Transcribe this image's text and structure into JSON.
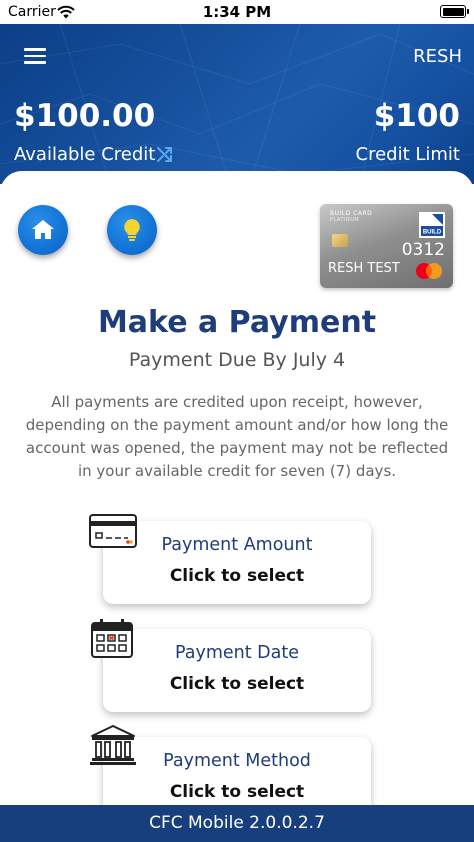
{
  "status_bar": {
    "carrier": "Carrier",
    "time": "1:34 PM"
  },
  "header": {
    "user": "RESH",
    "available_amount": "$100.00",
    "available_label": "Available Credit",
    "limit_amount": "$100",
    "limit_label": "Credit Limit"
  },
  "card": {
    "brand": "BUILD CARD",
    "subtitle": "PLATINUM",
    "logo_text": "BUILD",
    "last4": "0312",
    "holder": "RESH TEST"
  },
  "payment": {
    "title": "Make a Payment",
    "due": "Payment Due By July 4",
    "notice": "All payments are credited upon receipt, however, depending on the payment amount and/or how long the account was opened, the payment may not be reflected in your available credit for seven (7) days.",
    "fields": [
      {
        "label": "Payment Amount",
        "value": "Click to select"
      },
      {
        "label": "Payment Date",
        "value": "Click to select"
      },
      {
        "label": "Payment Method",
        "value": "Click to select"
      }
    ]
  },
  "footer": {
    "version": "CFC Mobile 2.0.0.2.7"
  },
  "colors": {
    "header_blue": "#1551a2",
    "title_navy": "#1f3d7a",
    "button_blue": "#1273d6",
    "footer_navy": "#173f7e",
    "bulb_yellow": "#f5d330"
  }
}
